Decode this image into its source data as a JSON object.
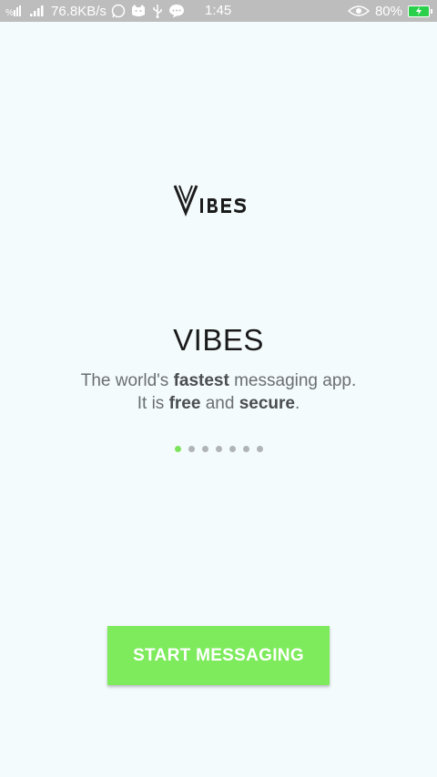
{
  "status_bar": {
    "network_speed": "76.8KB/s",
    "time": "1:45",
    "battery_percent": "80%",
    "icons": [
      "sim-signal-icon",
      "signal-bars-icon",
      "whatsapp-icon",
      "cat-icon",
      "usb-icon",
      "chat-icon",
      "eye-icon",
      "battery-charging-icon"
    ]
  },
  "onboarding": {
    "title": "VIBES",
    "line1_pre": "The world's ",
    "line1_bold": "fastest",
    "line1_post": " messaging app.",
    "line2_pre": "It is ",
    "line2_bold1": "free",
    "line2_mid": " and ",
    "line2_bold2": "secure",
    "line2_post": ".",
    "page_count": 7,
    "active_page": 1
  },
  "start_button": {
    "label": "START MESSAGING"
  },
  "colors": {
    "accent": "#7deb5c",
    "background": "#f4fbfd",
    "status_bar": "#bdbdbd"
  }
}
